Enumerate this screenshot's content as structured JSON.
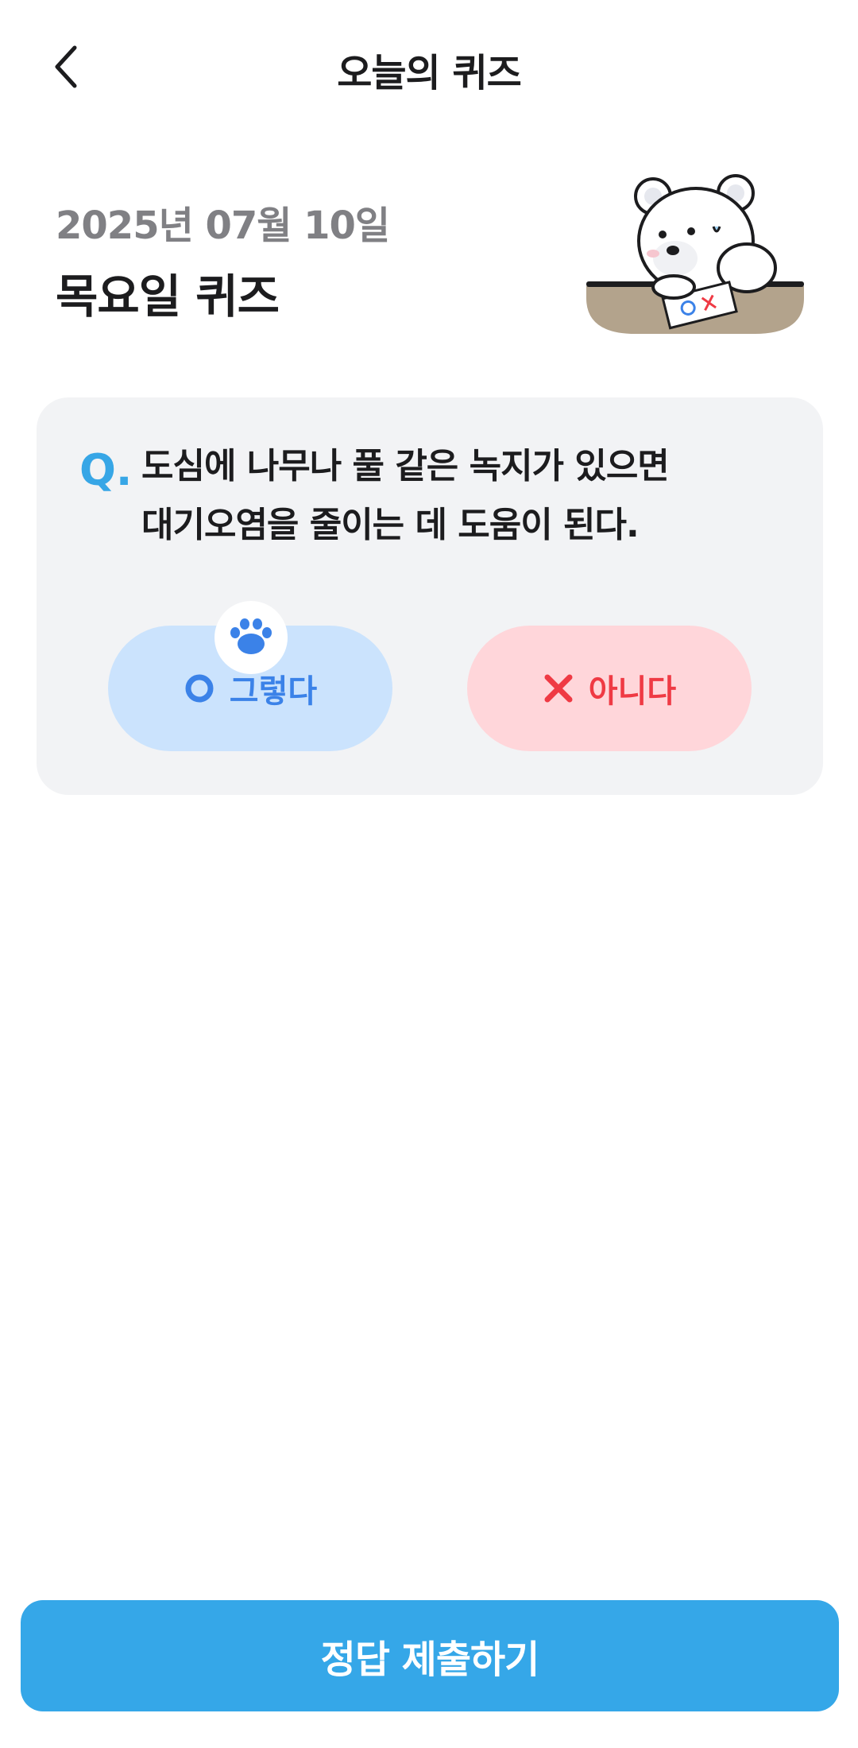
{
  "header": {
    "title": "오늘의 퀴즈",
    "back_icon": "chevron-left-icon"
  },
  "quiz_info": {
    "date": "2025년 07월 10일",
    "title": "목요일 퀴즈"
  },
  "mascot": {
    "icon": "polar-bear-mascot",
    "paper_text": "OX"
  },
  "question": {
    "prefix": "Q.",
    "line1": "도심에 나무나 풀 같은 녹지가 있으면",
    "line2": "대기오염을 줄이는 데 도움이 된다."
  },
  "answers": {
    "yes_label": "그렇다",
    "yes_icon": "circle-o-icon",
    "no_label": "아니다",
    "no_icon": "x-mark-icon",
    "selected_indicator": "paw-icon"
  },
  "submit": {
    "label": "정답 제출하기"
  },
  "colors": {
    "accent": "#35a7e8",
    "yes_bg": "#cbe3fd",
    "yes_text": "#3b82e8",
    "no_bg": "#ffd6da",
    "no_text": "#ef3a44",
    "card_bg": "#f2f3f5"
  }
}
